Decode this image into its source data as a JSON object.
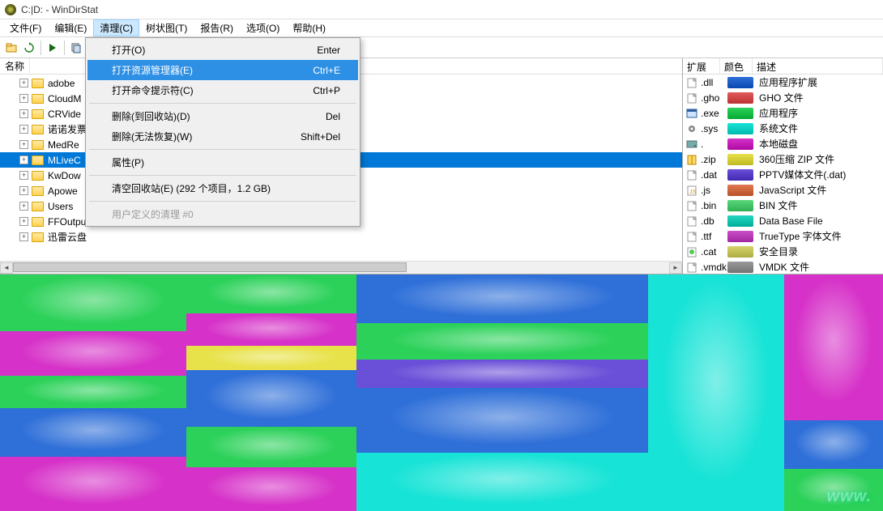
{
  "title": "C:|D: - WinDirStat",
  "menubar": [
    "文件(F)",
    "编辑(E)",
    "清理(C)",
    "树状图(T)",
    "报告(R)",
    "选项(O)",
    "帮助(H)"
  ],
  "active_menu_index": 2,
  "dropdown": {
    "items": [
      {
        "label": "打开(O)",
        "shortcut": "Enter",
        "type": "item"
      },
      {
        "label": "打开资源管理器(E)",
        "shortcut": "Ctrl+E",
        "type": "item",
        "hover": true
      },
      {
        "label": "打开命令提示符(C)",
        "shortcut": "Ctrl+P",
        "type": "item"
      },
      {
        "type": "sep"
      },
      {
        "label": "删除(到回收站)(D)",
        "shortcut": "Del",
        "type": "item"
      },
      {
        "label": "删除(无法恢复)(W)",
        "shortcut": "Shift+Del",
        "type": "item"
      },
      {
        "type": "sep"
      },
      {
        "label": "属性(P)",
        "shortcut": "",
        "type": "item"
      },
      {
        "type": "sep"
      },
      {
        "label": "清空回收站(E) (292 个项目，1.2 GB)",
        "shortcut": "",
        "type": "item"
      },
      {
        "type": "sep"
      },
      {
        "label": "用户定义的清理 #0",
        "shortcut": "",
        "type": "item",
        "disabled": true
      }
    ]
  },
  "tree_header": "名称",
  "tree_items": [
    {
      "name": "adobe"
    },
    {
      "name": "CloudM"
    },
    {
      "name": "CRVide"
    },
    {
      "name": "诺诺发票"
    },
    {
      "name": "MedRe"
    },
    {
      "name": "MLiveC",
      "selected": true
    },
    {
      "name": "KwDow"
    },
    {
      "name": "Apowe"
    },
    {
      "name": "Users"
    },
    {
      "name": "FFOutput"
    },
    {
      "name": "迅雷云盘"
    }
  ],
  "ext_headers": {
    "ext": "扩展",
    "color": "颜色",
    "desc": "描述"
  },
  "ext_rows": [
    {
      "ext": ".dll",
      "color": "#2e6fd8",
      "desc": "应用程序扩展",
      "icon": "file"
    },
    {
      "ext": ".gho",
      "color": "#e25a5a",
      "desc": "GHO 文件",
      "icon": "file"
    },
    {
      "ext": ".exe",
      "color": "#2bd159",
      "desc": "应用程序",
      "icon": "exe"
    },
    {
      "ext": ".sys",
      "color": "#17e3d6",
      "desc": "系统文件",
      "icon": "gear"
    },
    {
      "ext": ".",
      "color": "#d631c8",
      "desc": "本地磁盘",
      "icon": "disk"
    },
    {
      "ext": ".zip",
      "color": "#e8e24a",
      "desc": "360压缩 ZIP 文件",
      "icon": "zip"
    },
    {
      "ext": ".dat",
      "color": "#6a4fd8",
      "desc": "PPTV媒体文件(.dat)",
      "icon": "file"
    },
    {
      "ext": ".js",
      "color": "#e07850",
      "desc": "JavaScript 文件",
      "icon": "js"
    },
    {
      "ext": ".bin",
      "color": "#58d87a",
      "desc": "BIN 文件",
      "icon": "file"
    },
    {
      "ext": ".db",
      "color": "#23d6c0",
      "desc": "Data Base File",
      "icon": "file"
    },
    {
      "ext": ".ttf",
      "color": "#c94fc9",
      "desc": "TrueType 字体文件",
      "icon": "file"
    },
    {
      "ext": ".cat",
      "color": "#d4d46a",
      "desc": "安全目录",
      "icon": "cat"
    },
    {
      "ext": ".vmdk",
      "color": "#9a9a9a",
      "desc": "VMDK 文件",
      "icon": "file"
    }
  ],
  "watermark": "www."
}
